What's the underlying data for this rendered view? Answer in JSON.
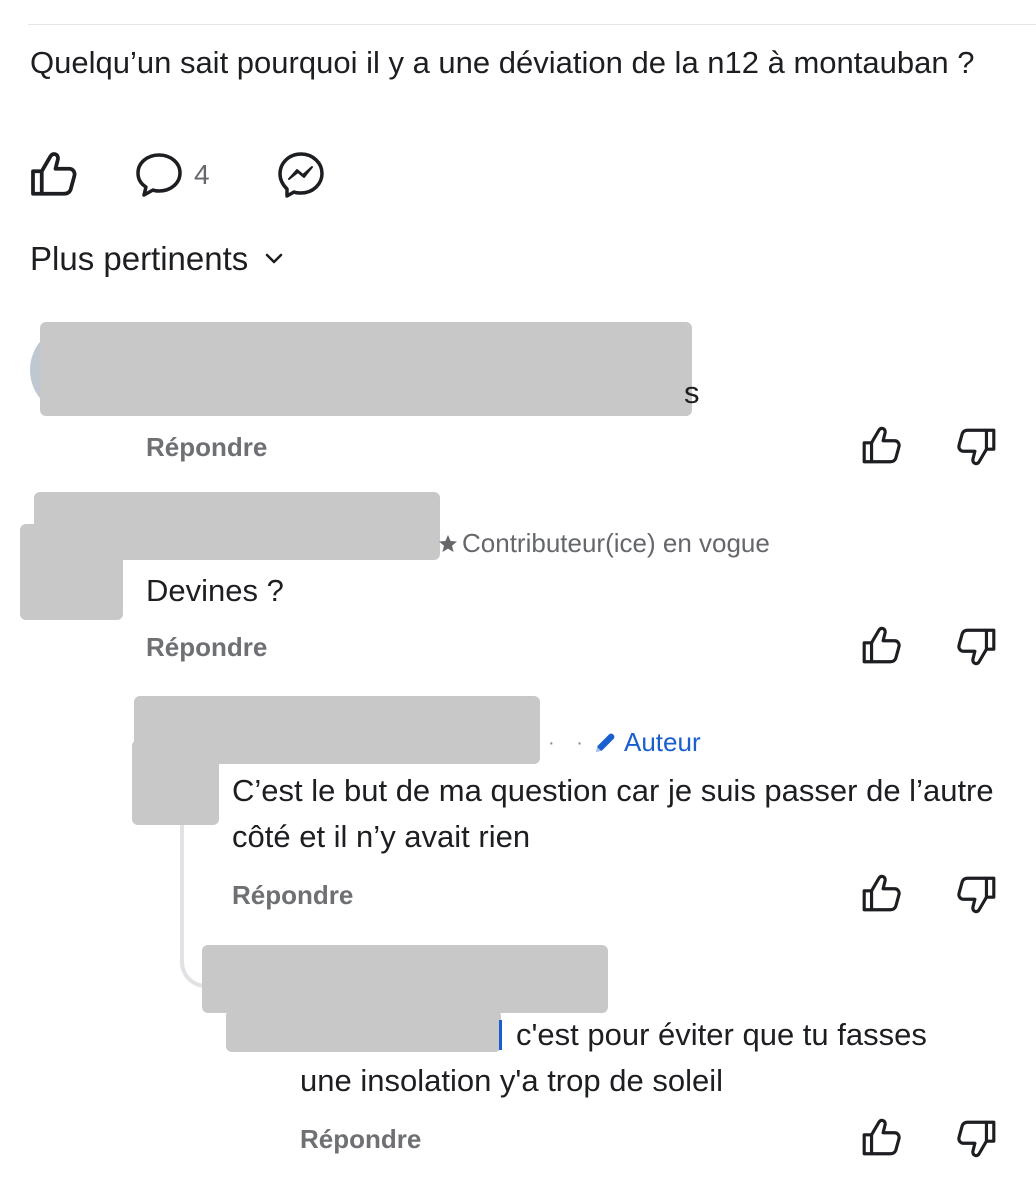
{
  "post": {
    "text": "Quelqu’un sait pourquoi il y a une déviation de la n12 à montauban ?",
    "comment_count": "4"
  },
  "sort": {
    "label": "Plus pertinents"
  },
  "comments": [
    {
      "trailing_text": "s",
      "reply_label": "Répondre"
    },
    {
      "badge": "Contributeur(ice) en vogue",
      "text": "Devines ?",
      "reply_label": "Répondre"
    },
    {
      "badge": "Auteur",
      "text": "C’est le but de ma question car je suis passer de l’autre côté et il n’y avait rien",
      "reply_label": "Répondre"
    },
    {
      "text": "c'est pour éviter que tu fasses une insolation y'a trop de soleil",
      "reply_label": "Répondre"
    }
  ],
  "icons": {
    "like": "thumbs-up-icon",
    "comment": "comment-bubble-icon",
    "share": "messenger-icon",
    "sort_chevron": "chevron-down-icon",
    "comment_like": "thumbs-up-icon",
    "comment_dislike": "thumbs-down-icon",
    "author_badge": "pencil-icon",
    "star": "star-icon"
  },
  "colors": {
    "author_badge": "#1a5fd0",
    "reply_label": "#6e7074",
    "redaction": "#c8c8c8"
  }
}
